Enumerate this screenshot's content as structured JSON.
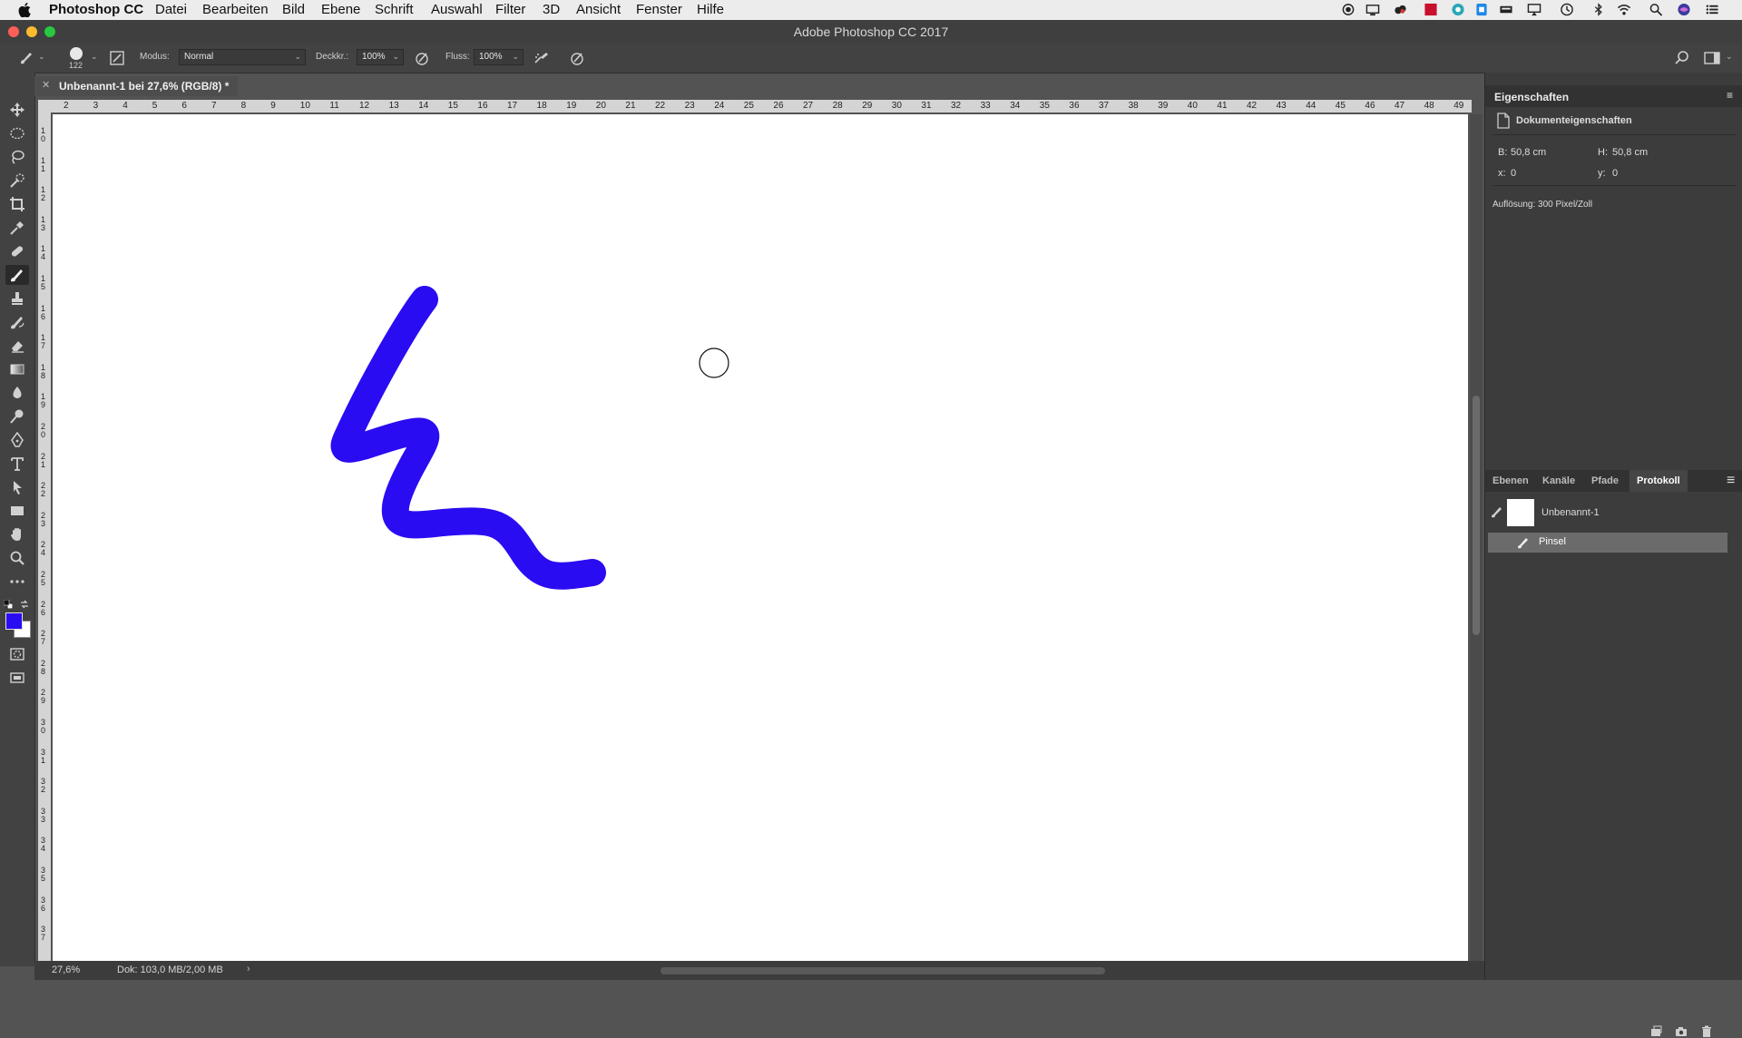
{
  "menubar": {
    "app": "Photoshop CC",
    "items": [
      "Datei",
      "Bearbeiten",
      "Bild",
      "Ebene",
      "Schrift",
      "Auswahl",
      "Filter",
      "3D",
      "Ansicht",
      "Fenster",
      "Hilfe"
    ]
  },
  "window": {
    "title": "Adobe Photoshop CC 2017"
  },
  "options": {
    "brush_size": "122",
    "mode_label": "Modus:",
    "mode_value": "Normal",
    "opacity_label": "Deckkr.:",
    "opacity_value": "100%",
    "flow_label": "Fluss:",
    "flow_value": "100%"
  },
  "document": {
    "tab_label": "Unbenannt-1 bei 27,6% (RGB/8) *"
  },
  "rulers": {
    "horizontal": [
      "2",
      "3",
      "4",
      "5",
      "6",
      "7",
      "8",
      "9",
      "10",
      "11",
      "12",
      "13",
      "14",
      "15",
      "16",
      "17",
      "18",
      "19",
      "20",
      "21",
      "22",
      "23",
      "24",
      "25",
      "26",
      "27",
      "28",
      "29",
      "30",
      "31",
      "32",
      "33",
      "34",
      "35",
      "36",
      "37",
      "38",
      "39",
      "40",
      "41",
      "42",
      "43",
      "44",
      "45",
      "46",
      "47",
      "48",
      "49"
    ],
    "vertical": [
      "10",
      "11",
      "12",
      "13",
      "14",
      "15",
      "16",
      "17",
      "18",
      "19",
      "20",
      "21",
      "22",
      "23",
      "24",
      "25",
      "26",
      "27",
      "28",
      "29",
      "30",
      "31",
      "32",
      "33",
      "34",
      "35",
      "36",
      "37"
    ]
  },
  "colors": {
    "foreground": "#2a0cf2",
    "background": "#ffffff",
    "brush_stroke": "#2a0cf2"
  },
  "status": {
    "zoom": "27,6%",
    "doc_size": "Dok: 103,0 MB/2,00 MB"
  },
  "properties": {
    "title": "Eigenschaften",
    "section": "Dokumenteigenschaften",
    "width_label": "B:",
    "width_value": "50,8 cm",
    "height_label": "H:",
    "height_value": "50,8 cm",
    "x_label": "x:",
    "x_value": "0",
    "y_label": "y:",
    "y_value": "0",
    "resolution": "Auflösung: 300 Pixel/Zoll"
  },
  "panel_tabs": [
    "Ebenen",
    "Kanäle",
    "Pfade",
    "Protokoll"
  ],
  "active_tab": "Protokoll",
  "history": {
    "snapshot": "Unbenannt-1",
    "steps": [
      "Pinsel"
    ]
  }
}
